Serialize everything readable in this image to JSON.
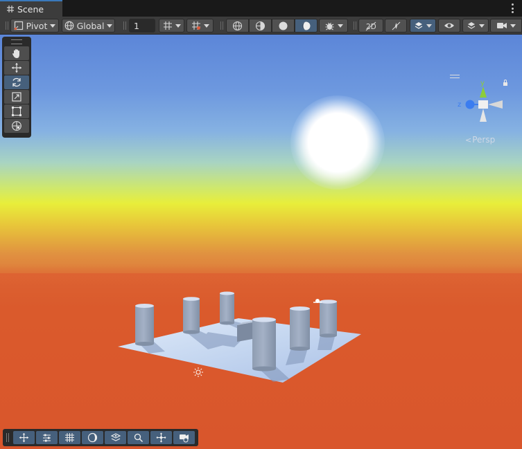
{
  "window": {
    "tab_label": "Scene",
    "tab_icon": "grid-icon"
  },
  "toolbar": {
    "pivot_label": "Pivot",
    "space_label": "Global",
    "grid_size_value": "1"
  },
  "gizmo": {
    "y_label": "y",
    "z_label": "z",
    "projection_label": "Persp"
  },
  "colors": {
    "panel": "#3c3c3c",
    "active_button": "#46607c",
    "sky_top": "#5c86d8",
    "horizon_yellow": "#e8ee3a",
    "ground": "#dc6232",
    "axis_x": "#db3a27",
    "axis_y": "#8ccd3a",
    "axis_z": "#3b7df0"
  },
  "tools": [
    "view-tool",
    "move-tool",
    "rotate-tool",
    "scale-tool",
    "rect-tool",
    "transform-tool"
  ],
  "active_tool": "rotate-tool",
  "overlays": [
    "tool-settings",
    "grid-and-snap",
    "view-options",
    "orientation",
    "search",
    "component-tools",
    "cameras"
  ]
}
